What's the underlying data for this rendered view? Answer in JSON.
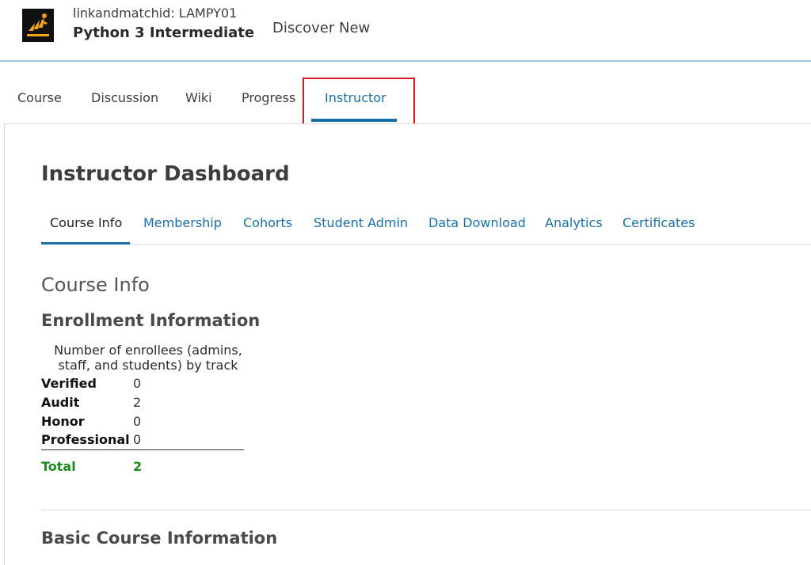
{
  "header": {
    "org_label": "linkandmatchid: LAMPY01",
    "course_title": "Python 3 Intermediate",
    "discover_link": "Discover New"
  },
  "course_tabs": [
    {
      "label": "Course",
      "active": false
    },
    {
      "label": "Discussion",
      "active": false
    },
    {
      "label": "Wiki",
      "active": false
    },
    {
      "label": "Progress",
      "active": false
    },
    {
      "label": "Instructor",
      "active": true
    }
  ],
  "dashboard": {
    "title": "Instructor Dashboard",
    "tabs": [
      {
        "label": "Course Info",
        "active": true
      },
      {
        "label": "Membership",
        "active": false
      },
      {
        "label": "Cohorts",
        "active": false
      },
      {
        "label": "Student Admin",
        "active": false
      },
      {
        "label": "Data Download",
        "active": false
      },
      {
        "label": "Analytics",
        "active": false
      },
      {
        "label": "Certificates",
        "active": false
      }
    ]
  },
  "course_info": {
    "section_title": "Course Info",
    "enrollment": {
      "title": "Enrollment Information",
      "description": "Number of enrollees (admins, staff, and students) by track",
      "rows": [
        {
          "label": "Verified",
          "value": "0"
        },
        {
          "label": "Audit",
          "value": "2"
        },
        {
          "label": "Honor",
          "value": "0"
        },
        {
          "label": "Professional",
          "value": "0"
        }
      ],
      "total_label": "Total",
      "total_value": "2"
    },
    "basic_title": "Basic Course Information"
  },
  "colors": {
    "accent": "#1b6fa6",
    "highlight": "#d9191f",
    "total": "#1e8a1e"
  }
}
